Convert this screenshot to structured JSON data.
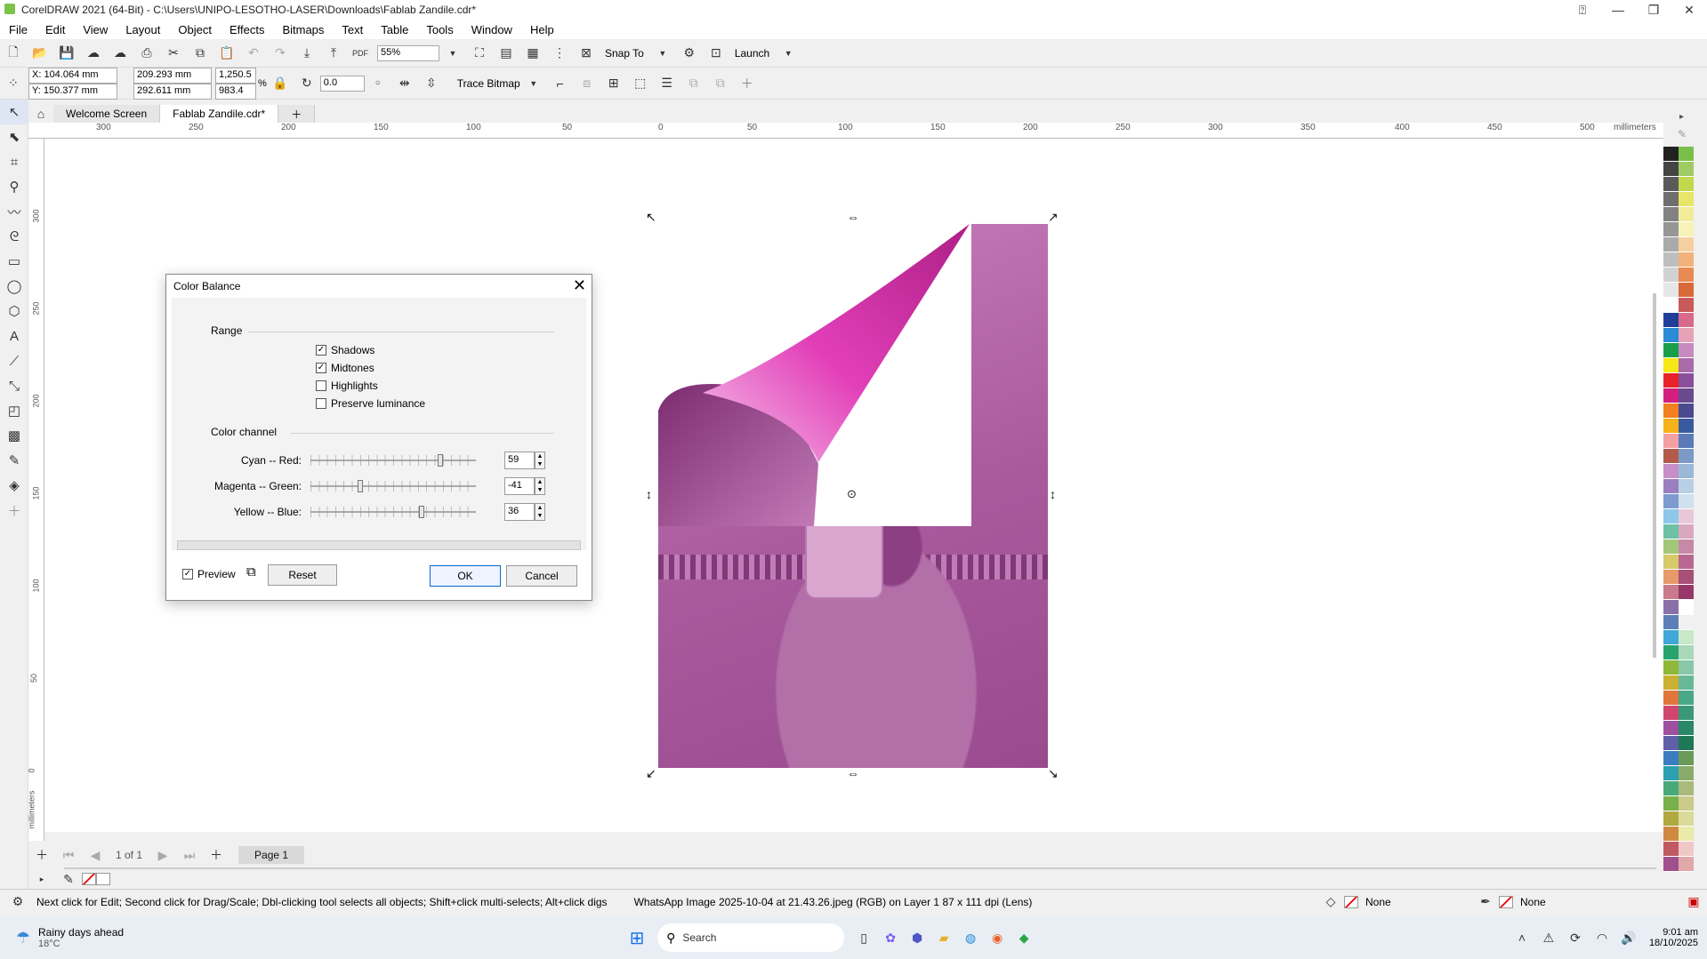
{
  "window": {
    "title": "CorelDRAW 2021 (64-Bit) - C:\\Users\\UNIPO-LESOTHO-LASER\\Downloads\\Fablab Zandile.cdr*"
  },
  "menu": [
    "File",
    "Edit",
    "View",
    "Layout",
    "Object",
    "Effects",
    "Bitmaps",
    "Text",
    "Table",
    "Tools",
    "Window",
    "Help"
  ],
  "toolbar": {
    "zoom": "55%",
    "snap_to": "Snap To",
    "launch": "Launch"
  },
  "properties": {
    "x": "X: 104.064 mm",
    "y": "Y: 150.377 mm",
    "w": "209.293 mm",
    "h": "292.611 mm",
    "sx": "1,250.5",
    "sy": "983.4",
    "pct": "%",
    "rotation": "0.0",
    "trace": "Trace Bitmap"
  },
  "tabs": {
    "welcome": "Welcome Screen",
    "doc": "Fablab Zandile.cdr*"
  },
  "ruler": {
    "units": "millimeters",
    "h_labels": [
      "300",
      "250",
      "200",
      "150",
      "100",
      "50",
      "0",
      "50",
      "100",
      "150",
      "200",
      "250",
      "300",
      "350",
      "400",
      "450",
      "500"
    ],
    "v_labels": [
      "300",
      "250",
      "200",
      "150",
      "100",
      "50",
      "0"
    ],
    "v_units": "millimeters"
  },
  "dialog": {
    "title": "Color Balance",
    "range_label": "Range",
    "checks": [
      {
        "label": "Shadows",
        "checked": true
      },
      {
        "label": "Midtones",
        "checked": true
      },
      {
        "label": "Highlights",
        "checked": false
      },
      {
        "label": "Preserve luminance",
        "checked": false
      }
    ],
    "channel_label": "Color channel",
    "sliders": [
      {
        "label": "Cyan -- Red:",
        "value": "59",
        "level": 0.795
      },
      {
        "label": "Magenta -- Green:",
        "value": "-41",
        "level": 0.295
      },
      {
        "label": "Yellow -- Blue:",
        "value": "36",
        "level": 0.68
      }
    ],
    "preview_label": "Preview",
    "reset_label": "Reset",
    "ok_label": "OK",
    "cancel_label": "Cancel"
  },
  "pagenav": {
    "count": "1 of 1",
    "page": "Page 1"
  },
  "status": {
    "hint": "Next click for Edit; Second click for Drag/Scale; Dbl-clicking tool selects all objects; Shift+click multi-selects; Alt+click digs",
    "object": "WhatsApp Image 2025-10-04 at 21.43.26.jpeg (RGB) on Layer 1 87 x 111 dpi  (Lens)",
    "fill": "None",
    "outline": "None"
  },
  "taskbar": {
    "weather_title": "Rainy days ahead",
    "weather_temp": "18°C",
    "search": "Search",
    "time": "9:01 am",
    "date": "18/10/2025"
  },
  "palette_colors": [
    "#222222",
    "#444444",
    "#5a5a5a",
    "#6e6e6e",
    "#828282",
    "#969696",
    "#aaaaaa",
    "#bebebe",
    "#d2d2d2",
    "#e6e6e6",
    "#ffffff",
    "#1f3f99",
    "#2a8bd6",
    "#1a9e49",
    "#f6e716",
    "#e8242a",
    "#d21f7f",
    "#f08020",
    "#f6b21a",
    "#f3a0a3",
    "#b35a4a",
    "#c78fc7",
    "#9c7fc0",
    "#7d9bd0",
    "#8fc7e8",
    "#6fc1a6",
    "#a3c779",
    "#d8c96b",
    "#e89a6b",
    "#c97a8c",
    "#8a6fa8",
    "#5d7fb8",
    "#3fa8d8",
    "#29a36e",
    "#8fb83a",
    "#ccb034",
    "#e0763a",
    "#d0466e",
    "#9f4fa0",
    "#6060a8",
    "#3b7cc0",
    "#2aa0b0",
    "#48a978",
    "#78b04a",
    "#b0a840",
    "#d08a40",
    "#c05a60",
    "#a0508e",
    "#7a5aa0",
    "#5a6aae",
    "#3a8ab8",
    "#38a0a0",
    "#58a870",
    "#88a850"
  ],
  "palette_colors2": [
    "#7bbf4b",
    "#9ecb62",
    "#c2d94e",
    "#e8e56a",
    "#f1ec9a",
    "#f6f2b8",
    "#f4d0a0",
    "#f2b27a",
    "#e88a52",
    "#d86a3a",
    "#c85a5a",
    "#d86a8a",
    "#e8a2b8",
    "#c88ac0",
    "#a86aa8",
    "#88509a",
    "#6a4a8e",
    "#4a4a8e",
    "#3a5aa0",
    "#5a7ab8",
    "#7a9ac8",
    "#9ab8d8",
    "#b8d0e6",
    "#d0e0ee",
    "#e8c8d8",
    "#d8a8c0",
    "#c888a8",
    "#b86890",
    "#a85078",
    "#983868",
    "#ffffff",
    "#f0f0f0",
    "#c8e8c8",
    "#a8d8b8",
    "#88c8a8",
    "#68b898",
    "#48a888",
    "#389878",
    "#2a8868",
    "#1f7858",
    "#6a9a5a",
    "#8aaa6a",
    "#aaba7a",
    "#caca8a",
    "#dada9a",
    "#eaeaaa",
    "#f0c8c8",
    "#e0a8a8",
    "#d08888",
    "#c06868",
    "#b04848",
    "#a02828",
    "#903060",
    "#803878"
  ]
}
